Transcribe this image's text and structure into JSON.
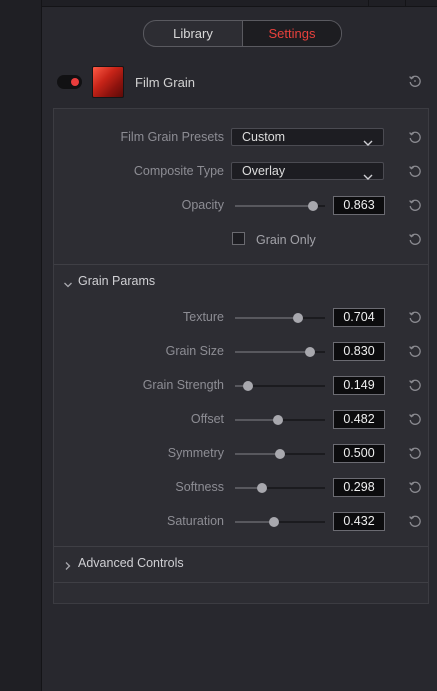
{
  "tabs": [
    {
      "label": "Library"
    },
    {
      "label": "Settings"
    }
  ],
  "active_tab": "Settings",
  "effect": {
    "name": "Film Grain",
    "enabled": true
  },
  "fields": {
    "presets": {
      "label": "Film Grain Presets",
      "value": "Custom"
    },
    "composite": {
      "label": "Composite Type",
      "value": "Overlay"
    },
    "opacity": {
      "label": "Opacity",
      "value": "0.863"
    },
    "grain_only": {
      "label": "Grain Only",
      "checked": false
    }
  },
  "grain_params": {
    "title": "Grain Params",
    "expanded": true,
    "items": [
      {
        "label": "Texture",
        "value": "0.704"
      },
      {
        "label": "Grain Size",
        "value": "0.830"
      },
      {
        "label": "Grain Strength",
        "value": "0.149"
      },
      {
        "label": "Offset",
        "value": "0.482"
      },
      {
        "label": "Symmetry",
        "value": "0.500"
      },
      {
        "label": "Softness",
        "value": "0.298"
      },
      {
        "label": "Saturation",
        "value": "0.432"
      }
    ]
  },
  "advanced": {
    "title": "Advanced Controls",
    "expanded": false
  },
  "colors": {
    "accent": "#e8413c",
    "toggle_on": "#ea3d3d"
  }
}
